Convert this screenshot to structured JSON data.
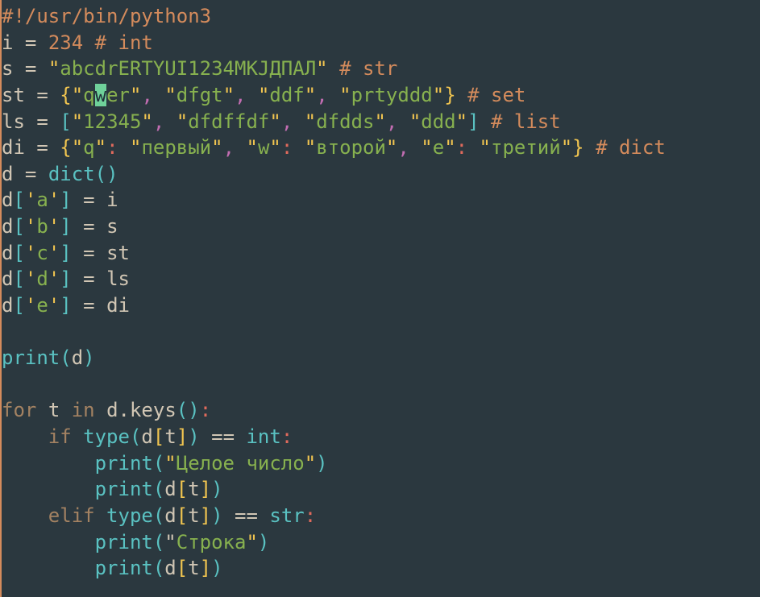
{
  "code": {
    "shebang": "#!/usr/bin/python3",
    "l2": {
      "var": "i",
      "eq": " = ",
      "num": "234",
      "sp": " ",
      "hash": "#",
      "cmt": " int"
    },
    "l3": {
      "var": "s",
      "eq": " = ",
      "q1": "\"",
      "str": "abcdrERTYUI1234MKJДПАЛ",
      "q2": "\"",
      "sp": " ",
      "hash": "#",
      "cmt": " str"
    },
    "l4": {
      "var": "st",
      "eq": " = ",
      "lb": "{",
      "q1o": "\"",
      "s1a": "q",
      "s1cur": "w",
      "s1b": "er",
      "q1c": "\"",
      "c1": ", ",
      "q2o": "\"",
      "s2": "dfgt",
      "q2c": "\"",
      "c2": ", ",
      "q3o": "\"",
      "s3": "ddf",
      "q3c": "\"",
      "c3": ", ",
      "q4o": "\"",
      "s4": "prtyddd",
      "q4c": "\"",
      "rb": "}",
      "sp": " ",
      "hash": "#",
      "cmt": " set"
    },
    "l5": {
      "var": "ls",
      "eq": " = ",
      "lb": "[",
      "q1o": "\"",
      "s1": "12345",
      "q1c": "\"",
      "c1": ", ",
      "q2o": "\"",
      "s2": "dfdffdf",
      "q2c": "\"",
      "c2": ", ",
      "q3o": "\"",
      "s3": "dfdds",
      "q3c": "\"",
      "c3": ", ",
      "q4o": "\"",
      "s4": "ddd",
      "q4c": "\"",
      "rb": "]",
      "sp": " ",
      "hash": "#",
      "cmt": " list"
    },
    "l6": {
      "var": "di",
      "eq": " = ",
      "lb": "{",
      "q1o": "\"",
      "k1": "q",
      "q1c": "\"",
      "col1": ":",
      "sp1": " ",
      "q1vo": "\"",
      "v1": "первый",
      "q1vc": "\"",
      "c1": ", ",
      "q2o": "\"",
      "k2": "w",
      "q2c": "\"",
      "col2": ":",
      "sp2": " ",
      "q2vo": "\"",
      "v2": "второй",
      "q2vc": "\"",
      "c2": ", ",
      "q3o": "\"",
      "k3": "e",
      "q3c": "\"",
      "col3": ":",
      "sp3": " ",
      "q3vo": "\"",
      "v3": "третий",
      "q3vc": "\"",
      "rb": "}",
      "sp": " ",
      "hash": "#",
      "cmt": " dict"
    },
    "l7": {
      "var": "d",
      "eq": " = ",
      "fn": "dict",
      "lp": "(",
      "rp": ")"
    },
    "l8": {
      "var": "d",
      "lb": "[",
      "q": "'",
      "k": "a",
      "q2": "'",
      "rb": "]",
      "eq": " = ",
      "rhs": "i"
    },
    "l9": {
      "var": "d",
      "lb": "[",
      "q": "'",
      "k": "b",
      "q2": "'",
      "rb": "]",
      "eq": " = ",
      "rhs": "s"
    },
    "l10": {
      "var": "d",
      "lb": "[",
      "q": "'",
      "k": "c",
      "q2": "'",
      "rb": "]",
      "eq": " = ",
      "rhs": "st"
    },
    "l11": {
      "var": "d",
      "lb": "[",
      "q": "'",
      "k": "d",
      "q2": "'",
      "rb": "]",
      "eq": " = ",
      "rhs": "ls"
    },
    "l12": {
      "var": "d",
      "lb": "[",
      "q": "'",
      "k": "e",
      "q2": "'",
      "rb": "]",
      "eq": " = ",
      "rhs": "di"
    },
    "l14": {
      "fn": "print",
      "lp": "(",
      "arg": "d",
      "rp": ")"
    },
    "l16": {
      "kw1": "for",
      "sp1": " ",
      "v": "t",
      "sp2": " ",
      "kw2": "in",
      "sp3": " ",
      "obj": "d",
      "dot": ".",
      "meth": "keys",
      "lp": "(",
      "rp": ")",
      "col": ":"
    },
    "l17": {
      "ind": "    ",
      "kw": "if",
      "sp": " ",
      "fn": "type",
      "lp": "(",
      "obj": "d",
      "lb": "[",
      "v": "t",
      "rb": "]",
      "rp": ")",
      "sp2": " ",
      "eq": "==",
      "sp3": " ",
      "ty": "int",
      "col": ":"
    },
    "l18": {
      "ind": "        ",
      "fn": "print",
      "lp": "(",
      "q1": "\"",
      "s": "Целое число",
      "q2": "\"",
      "rp": ")"
    },
    "l19": {
      "ind": "        ",
      "fn": "print",
      "lp": "(",
      "obj": "d",
      "lb": "[",
      "v": "t",
      "rb": "]",
      "rp": ")"
    },
    "l20": {
      "ind": "    ",
      "kw": "elif",
      "sp": " ",
      "fn": "type",
      "lp": "(",
      "obj": "d",
      "lb": "[",
      "v": "t",
      "rb": "]",
      "rp": ")",
      "sp2": " ",
      "eq": "==",
      "sp3": " ",
      "ty": "str",
      "col": ":"
    },
    "l21": {
      "ind": "        ",
      "fn": "print",
      "lp": "(",
      "q1": "\"",
      "s": "Строка",
      "q2": "\"",
      "rp": ")"
    },
    "l22": {
      "ind": "        ",
      "fn": "print",
      "lp": "(",
      "obj": "d",
      "lb": "[",
      "v": "t",
      "rb": "]",
      "rp": ")"
    }
  }
}
